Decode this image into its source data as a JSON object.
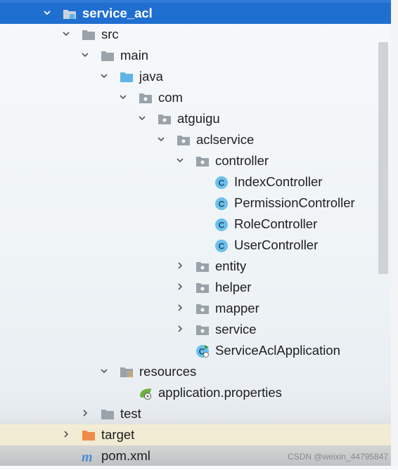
{
  "tree": {
    "items": [
      {
        "label": "service_acl",
        "icon": "module-folder-icon",
        "expanded": true
      },
      {
        "label": "src",
        "icon": "folder-icon",
        "expanded": true
      },
      {
        "label": "main",
        "icon": "folder-icon",
        "expanded": true
      },
      {
        "label": "java",
        "icon": "source-root-folder-icon",
        "expanded": true
      },
      {
        "label": "com",
        "icon": "package-icon",
        "expanded": true
      },
      {
        "label": "atguigu",
        "icon": "package-icon",
        "expanded": true
      },
      {
        "label": "aclservice",
        "icon": "package-icon",
        "expanded": true
      },
      {
        "label": "controller",
        "icon": "package-icon",
        "expanded": true
      },
      {
        "label": "IndexController",
        "icon": "class-icon"
      },
      {
        "label": "PermissionController",
        "icon": "class-icon"
      },
      {
        "label": "RoleController",
        "icon": "class-icon"
      },
      {
        "label": "UserController",
        "icon": "class-icon"
      },
      {
        "label": "entity",
        "icon": "package-icon",
        "expanded": false
      },
      {
        "label": "helper",
        "icon": "package-icon",
        "expanded": false
      },
      {
        "label": "mapper",
        "icon": "package-icon",
        "expanded": false
      },
      {
        "label": "service",
        "icon": "package-icon",
        "expanded": false
      },
      {
        "label": "ServiceAclApplication",
        "icon": "spring-boot-class-icon"
      },
      {
        "label": "resources",
        "icon": "resources-folder-icon",
        "expanded": true
      },
      {
        "label": "application.properties",
        "icon": "spring-properties-icon"
      },
      {
        "label": "test",
        "icon": "folder-icon",
        "expanded": false
      },
      {
        "label": "target",
        "icon": "excluded-folder-icon",
        "expanded": false
      },
      {
        "label": "pom.xml",
        "icon": "maven-icon"
      }
    ]
  },
  "watermark": "CSDN @weixin_44795847",
  "colors": {
    "selection": "#1f6fd0",
    "folder": "#9aa3aa",
    "source_root": "#5fb4e6",
    "class_icon": "#3da7e0",
    "excluded": "#f08a4b"
  }
}
